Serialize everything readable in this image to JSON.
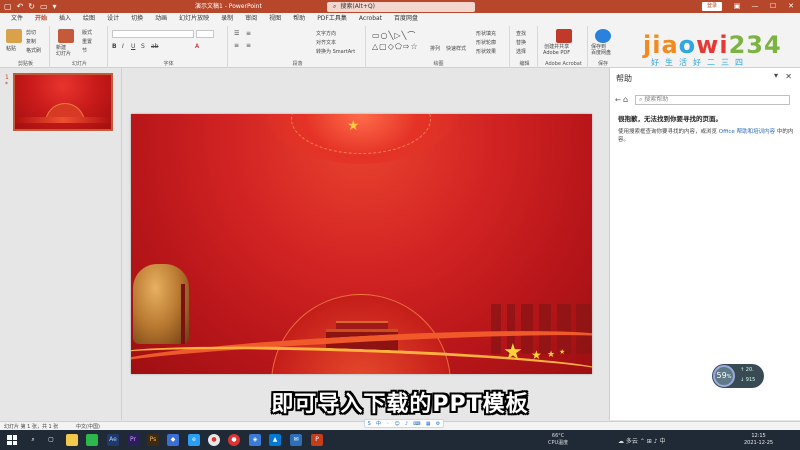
{
  "titlebar": {
    "title": "演示文稿1 - PowerPoint",
    "search_placeholder": "搜索(Alt+Q)",
    "login_label": "登录",
    "colors": {
      "accent": "#b7472a"
    }
  },
  "tabs": [
    "文件",
    "开始",
    "插入",
    "绘图",
    "设计",
    "切换",
    "动画",
    "幻灯片放映",
    "录制",
    "审阅",
    "视图",
    "帮助",
    "PDF工具集",
    "Acrobat",
    "百度网盘"
  ],
  "active_tab": "开始",
  "ribbon": {
    "groups": {
      "clipboard": {
        "label": "剪贴板",
        "paste": "粘贴",
        "cut": "剪切",
        "copy": "复制",
        "format": "格式刷"
      },
      "slides": {
        "label": "幻灯片",
        "new_slide": "新建\n幻灯片",
        "layout": "版式",
        "reset": "重置",
        "section": "节"
      },
      "font": {
        "label": "字体"
      },
      "paragraph": {
        "label": "段落",
        "text_direction": "文字方向",
        "align_text": "对齐文本",
        "smartart": "转换为 SmartArt"
      },
      "drawing": {
        "label": "绘图",
        "arrange": "排列",
        "quick_styles": "快速样式",
        "shape_fill": "形状填充",
        "shape_outline": "形状轮廓",
        "shape_effects": "形状效果"
      },
      "editing": {
        "label": "编辑",
        "find": "查找",
        "replace": "替换",
        "select": "选择"
      },
      "adobe": {
        "label": "Adobe Acrobat",
        "create_pdf": "创建并共享\nAdobe PDF"
      },
      "save": {
        "label": "保存",
        "save_to": "保存到\n百度网盘"
      }
    }
  },
  "logo": {
    "text": "jiaowi234",
    "subtitle": "好生活好二三四"
  },
  "thumbnail_pane": {
    "slide_number": "1",
    "star_mark": "*"
  },
  "help_pane": {
    "title": "帮助",
    "search_placeholder": "搜索帮助",
    "heading": "很抱歉，无法找到你要寻找的页面。",
    "body_prefix": "使用搜索框查询你要寻找的内容，或浏览",
    "body_link": "Office 帮助和培训内容",
    "body_suffix": "中的内容。"
  },
  "subtitle_text": "即可导入下载的PPT模板",
  "gauge": {
    "value": "59",
    "unit": "%",
    "up": "20.",
    "down": "915"
  },
  "statusbar": {
    "slide_info": "幻灯片 第 1 张，共 1 张",
    "language": "中文(中国)"
  },
  "taskbar": {
    "temperature": "66°C",
    "cpu_label": "CPU温度",
    "weather": "多云",
    "time": "12:15",
    "date": "2021-12-25"
  }
}
